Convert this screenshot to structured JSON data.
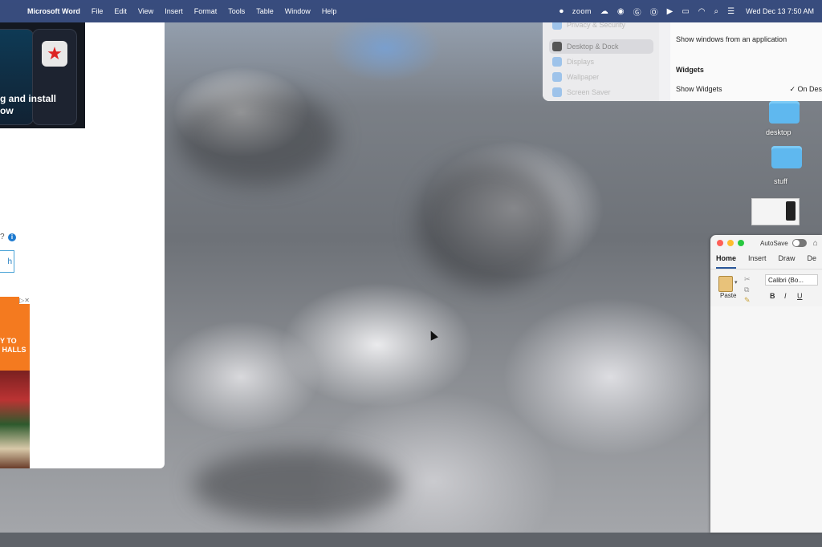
{
  "menubar": {
    "app_name": "Microsoft Word",
    "menus": [
      "File",
      "Edit",
      "View",
      "Insert",
      "Format",
      "Tools",
      "Table",
      "Window",
      "Help"
    ],
    "zoom_label": "zoom",
    "clock": "Wed Dec 13  7:50 AM"
  },
  "browser": {
    "promo_text": "g and install\now",
    "info_mark": "?",
    "input_text": "h",
    "ad_text": "Y TO\n HALLS",
    "ad_close": "▷✕"
  },
  "settings": {
    "sidebar_items": [
      "Privacy & Security",
      "Desktop & Dock",
      "Displays",
      "Wallpaper",
      "Screen Saver"
    ],
    "show_windows_label": "Show windows from an application",
    "widgets_heading": "Widgets",
    "show_widgets_label": "Show Widgets",
    "show_widgets_value": "✓ On Des"
  },
  "desktop": {
    "folders": [
      "desktop",
      "stuff"
    ]
  },
  "word": {
    "autosave_label": "AutoSave",
    "tabs": [
      "Home",
      "Insert",
      "Draw",
      "De"
    ],
    "paste_label": "Paste",
    "font_name": "Calibri (Bo...",
    "format_buttons": [
      "B",
      "I",
      "U"
    ]
  }
}
